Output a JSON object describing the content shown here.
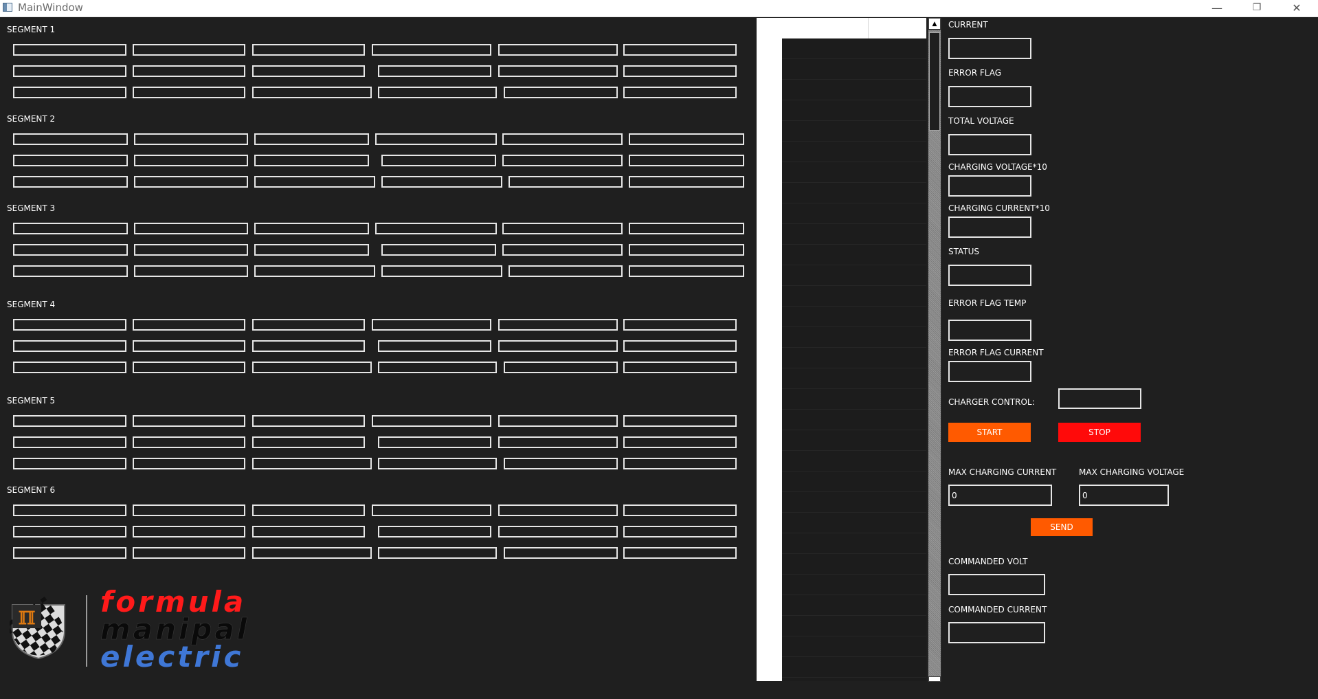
{
  "window": {
    "title": "MainWindow",
    "minimize_icon": "—",
    "restore_icon": "❐",
    "close_icon": "✕"
  },
  "segments": [
    {
      "label": "SEGMENT 1"
    },
    {
      "label": "SEGMENT 2"
    },
    {
      "label": "SEGMENT 3"
    },
    {
      "label": "SEGMENT 4"
    },
    {
      "label": "SEGMENT 5"
    },
    {
      "label": "SEGMENT 6"
    }
  ],
  "right_panel": {
    "current_label": "CURRENT",
    "error_flag_label": "ERROR FLAG",
    "total_voltage_label": "TOTAL VOLTAGE",
    "charging_voltage_label": "CHARGING VOLTAGE*10",
    "charging_current_label": "CHARGING CURRENT*10",
    "status_label": "STATUS",
    "error_flag_temp_label": "ERROR FLAG TEMP",
    "error_flag_current_label": "ERROR FLAG CURRENT",
    "charger_control_label": "CHARGER CONTROL:",
    "start_label": "START",
    "stop_label": "STOP",
    "max_charging_current_label": "MAX CHARGING CURRENT",
    "max_charging_current_value": "0",
    "max_charging_voltage_label": "MAX CHARGING VOLTAGE",
    "max_charging_voltage_value": "0",
    "send_label": "SEND",
    "commanded_volt_label": "COMMANDED VOLT",
    "commanded_current_label": "COMMANDED CURRENT"
  },
  "colors": {
    "background": "#1f1f1f",
    "accent_orange": "#ff5a00",
    "stop_red": "#ff0a0a",
    "logo_red": "#ff1a1a",
    "logo_blue": "#3f77d6"
  },
  "logo": {
    "word1": "formula",
    "word2": "manipal",
    "word3": "electric"
  }
}
